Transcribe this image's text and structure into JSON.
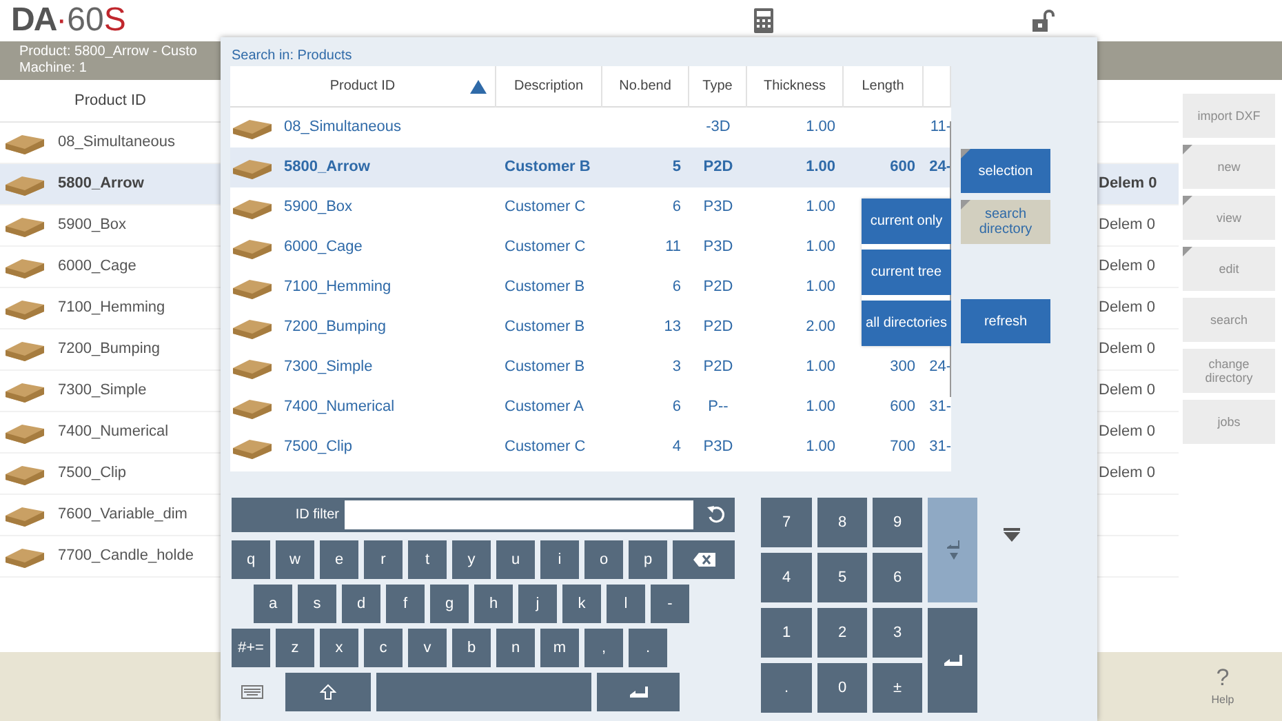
{
  "logo": {
    "brand": "DA",
    "separator": "·",
    "model": "60",
    "suffix": "S"
  },
  "info_bar": {
    "product": "Product: 5800_Arrow - Custo",
    "machine": "Machine: 1"
  },
  "product_list": {
    "column": "Product ID",
    "rows": [
      {
        "id": "08_Simultaneous",
        "selected": false
      },
      {
        "id": "5800_Arrow",
        "selected": true,
        "column_2": "Delem 0"
      },
      {
        "id": "5900_Box",
        "selected": false,
        "column_2": "Delem 0"
      },
      {
        "id": "6000_Cage",
        "selected": false,
        "column_2": "Delem 0"
      },
      {
        "id": "7100_Hemming",
        "selected": false,
        "column_2": "Delem 0"
      },
      {
        "id": "7200_Bumping",
        "selected": false,
        "column_2": "Delem 0"
      },
      {
        "id": "7300_Simple",
        "selected": false,
        "column_2": "Delem 0"
      },
      {
        "id": "7400_Numerical",
        "selected": false,
        "column_2": "Delem 0"
      },
      {
        "id": "7500_Clip",
        "selected": false,
        "column_2": "Delem 0"
      },
      {
        "id": "7600_Variable_dim",
        "selected": false
      },
      {
        "id": "7700_Candle_holde",
        "selected": false
      }
    ]
  },
  "side_buttons": [
    {
      "label": "import DXF",
      "disabled": true,
      "has_menu": false
    },
    {
      "label": "new",
      "disabled": true,
      "has_menu": true
    },
    {
      "label": "view",
      "disabled": true,
      "has_menu": true
    },
    {
      "label": "edit",
      "disabled": true,
      "has_menu": true
    },
    {
      "label": "search",
      "disabled": true,
      "has_menu": false
    },
    {
      "label": "change directory",
      "disabled": true,
      "has_menu": false
    },
    {
      "label": "jobs",
      "disabled": true,
      "has_menu": false
    }
  ],
  "help": {
    "icon": "?",
    "label": "Help"
  },
  "dialog": {
    "title": "Search in: Products",
    "table": {
      "columns": [
        {
          "label": "Product ID",
          "sorted": true
        },
        {
          "label": "Description",
          "sorted": false
        },
        {
          "label": "No.bend",
          "sorted": false
        },
        {
          "label": "Type",
          "sorted": false
        },
        {
          "label": "Thickness",
          "sorted": false
        },
        {
          "label": "Length",
          "sorted": false
        }
      ],
      "rows": [
        {
          "product_id": "08_Simultaneous",
          "type": "-3D",
          "thickness": "1.00",
          "column_7": "11-",
          "selected": false
        },
        {
          "product_id": "5800_Arrow",
          "description": "Customer B",
          "bends": "5",
          "type": "P2D",
          "thickness": "1.00",
          "length": "600",
          "column_7": "24-",
          "selected": true
        },
        {
          "product_id": "5900_Box",
          "description": "Customer C",
          "bends": "6",
          "type": "P3D",
          "thickness": "1.00",
          "selected": false
        },
        {
          "product_id": "6000_Cage",
          "description": "Customer C",
          "bends": "11",
          "type": "P3D",
          "thickness": "1.00",
          "selected": false
        },
        {
          "product_id": "7100_Hemming",
          "description": "Customer B",
          "bends": "6",
          "type": "P2D",
          "thickness": "1.00",
          "selected": false
        },
        {
          "product_id": "7200_Bumping",
          "description": "Customer B",
          "bends": "13",
          "type": "P2D",
          "thickness": "2.00",
          "selected": false
        },
        {
          "product_id": "7300_Simple",
          "description": "Customer B",
          "bends": "3",
          "type": "P2D",
          "thickness": "1.00",
          "length": "300",
          "column_7": "24-",
          "selected": false
        },
        {
          "product_id": "7400_Numerical",
          "description": "Customer A",
          "bends": "6",
          "type": "P--",
          "thickness": "1.00",
          "length": "600",
          "column_7": "31-",
          "selected": false
        },
        {
          "product_id": "7500_Clip",
          "description": "Customer C",
          "bends": "4",
          "type": "P3D",
          "thickness": "1.00",
          "length": "700",
          "column_7": "31-",
          "selected": false
        }
      ]
    },
    "scope_buttons": [
      {
        "label": "current only"
      },
      {
        "label": "current tree"
      },
      {
        "label": "all directories"
      }
    ],
    "action_buttons": [
      {
        "label": "selection",
        "active": false,
        "has_menu": true
      },
      {
        "label": "search directory",
        "active": true,
        "has_menu": true
      },
      {
        "label": "refresh",
        "active": false,
        "has_menu": false
      }
    ],
    "keyboard": {
      "filter_label": "ID filter",
      "rows": [
        [
          {
            "kind": "char",
            "label": "q"
          },
          {
            "kind": "char",
            "label": "w"
          },
          {
            "kind": "char",
            "label": "e"
          },
          {
            "kind": "char",
            "label": "r"
          },
          {
            "kind": "char",
            "label": "t"
          },
          {
            "kind": "char",
            "label": "y"
          },
          {
            "kind": "char",
            "label": "u"
          },
          {
            "kind": "char",
            "label": "i"
          },
          {
            "kind": "char",
            "label": "o"
          },
          {
            "kind": "char",
            "label": "p"
          },
          {
            "kind": "backspace"
          }
        ],
        [
          {
            "kind": "char",
            "label": "a"
          },
          {
            "kind": "char",
            "label": "s"
          },
          {
            "kind": "char",
            "label": "d"
          },
          {
            "kind": "char",
            "label": "f"
          },
          {
            "kind": "char",
            "label": "g"
          },
          {
            "kind": "char",
            "label": "h"
          },
          {
            "kind": "char",
            "label": "j"
          },
          {
            "kind": "char",
            "label": "k"
          },
          {
            "kind": "char",
            "label": "l"
          },
          {
            "kind": "char",
            "label": "-"
          }
        ],
        [
          {
            "kind": "char",
            "label": "#+="
          },
          {
            "kind": "char",
            "label": "z"
          },
          {
            "kind": "char",
            "label": "x"
          },
          {
            "kind": "char",
            "label": "c"
          },
          {
            "kind": "char",
            "label": "v"
          },
          {
            "kind": "char",
            "label": "b"
          },
          {
            "kind": "char",
            "label": "n"
          },
          {
            "kind": "char",
            "label": "m"
          },
          {
            "kind": "char",
            "label": ","
          },
          {
            "kind": "char",
            "label": "."
          }
        ],
        [
          {
            "kind": "shift"
          },
          {
            "kind": "space"
          },
          {
            "kind": "enter"
          }
        ]
      ]
    },
    "numpad": {
      "keys": [
        {
          "label": "7"
        },
        {
          "label": "8"
        },
        {
          "label": "9"
        },
        {
          "label": "4"
        },
        {
          "label": "5"
        },
        {
          "label": "6"
        },
        {
          "label": "1"
        },
        {
          "label": "2"
        },
        {
          "label": "3"
        },
        {
          "label": "."
        },
        {
          "label": "0"
        },
        {
          "label": "±"
        }
      ],
      "side_keys": [
        {
          "kind": "next"
        },
        {
          "kind": "enter"
        }
      ]
    }
  }
}
